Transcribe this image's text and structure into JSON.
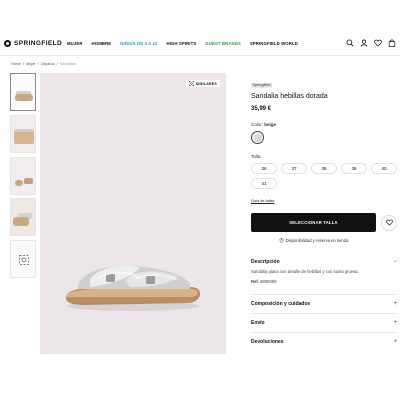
{
  "brand": {
    "name": "SPRINGFIELD"
  },
  "nav": {
    "items": [
      {
        "label": "MUJER",
        "color": "#111111"
      },
      {
        "label": "HOMBRE",
        "color": "#111111"
      },
      {
        "label": "NIÑO/A DE 3 A 12",
        "color": "#1f9bb5"
      },
      {
        "label": "HIGH SPIRITS",
        "color": "#111111"
      },
      {
        "label": "GUEST BRANDS",
        "color": "#2b9a4a"
      },
      {
        "label": "SPRINGFIELD WORLD",
        "color": "#111111"
      }
    ],
    "icons": [
      "search-icon",
      "user-icon",
      "heart-icon",
      "bag-icon"
    ]
  },
  "breadcrumb": [
    "Home",
    "/",
    "Mujer",
    "/",
    "Zapatos",
    "/",
    "Sandalias"
  ],
  "gallery": {
    "similares_label": "SIMILARES",
    "thumbnail_count": 5
  },
  "product": {
    "brand_tag": "Springfield",
    "title": "Sandalia hebillas dorada",
    "price": "35,99 €",
    "color_label": "Color:",
    "color_value": "beige",
    "talla_label": "Talla:",
    "sizes": [
      "36",
      "37",
      "38",
      "39",
      "40",
      "41"
    ],
    "size_guide": "Guía de tallas",
    "cta_label": "SELECCIONAR TALLA",
    "store_label": "Disponibilidad y reserva en tienda"
  },
  "accordion": {
    "description_title": "Descripción",
    "description_text": "Sandalia plana con detalle de hebillas y con suela gruesa.",
    "ref_label": "Ref.",
    "ref_value": "9889399",
    "composition_title": "Composición y cuidados",
    "shipping_title": "Envío",
    "returns_title": "Devoluciones",
    "expand_symbol": "+",
    "collapse_symbol": "−"
  }
}
